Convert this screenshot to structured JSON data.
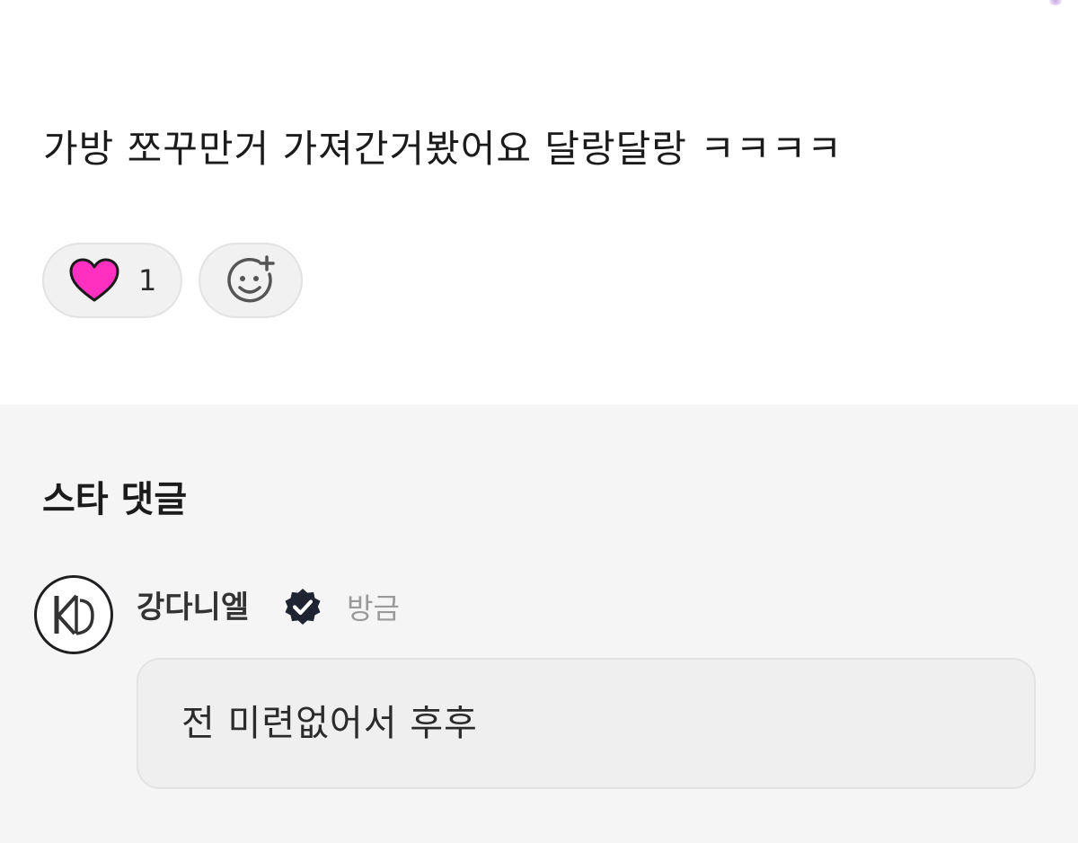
{
  "post": {
    "text": "가방 쪼꾸만거 가져간거봤어요 달랑달랑 ㅋㅋㅋㅋ",
    "reactions": {
      "heart_icon": "heart-icon",
      "heart_color": "#ff2fc0",
      "heart_count": "1",
      "add_reaction_icon": "smiley-plus-icon"
    }
  },
  "comments_section": {
    "title": "스타 댓글",
    "background_color": "#f5f5f5",
    "comments": [
      {
        "author": "강다니엘",
        "verified": true,
        "verified_icon": "verified-badge-icon",
        "verified_color": "#1f2433",
        "time": "방금",
        "text": "전 미련없어서 후후",
        "avatar_icon": "kd-logo-avatar"
      }
    ]
  }
}
